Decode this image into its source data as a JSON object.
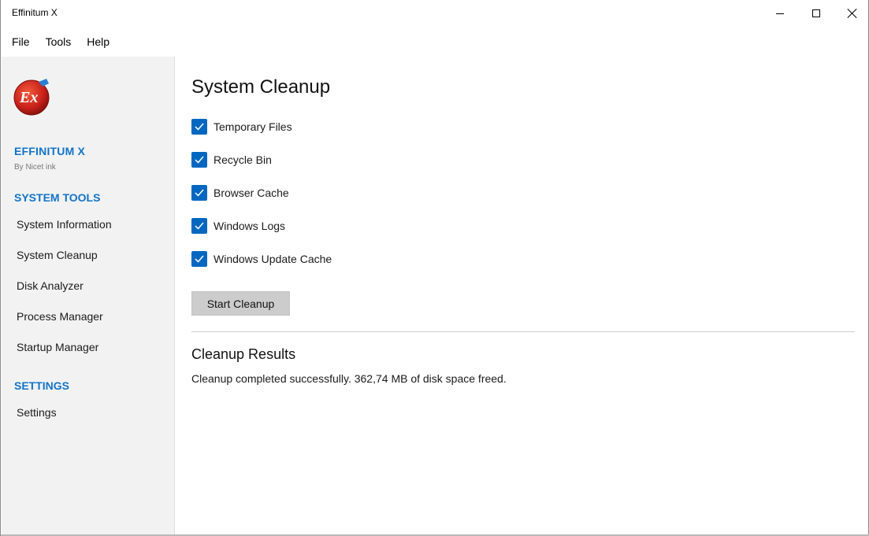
{
  "window": {
    "title": "Effinitum X"
  },
  "menu": [
    "File",
    "Tools",
    "Help"
  ],
  "sidebar": {
    "brand": "EFFINITUM X",
    "byline": "By Nicet ink",
    "logo_text": "Ex",
    "tools_title": "SYSTEM TOOLS",
    "tools": [
      "System Information",
      "System Cleanup",
      "Disk Analyzer",
      "Process Manager",
      "Startup Manager"
    ],
    "settings_title": "SETTINGS",
    "settings": [
      "Settings"
    ]
  },
  "main": {
    "title": "System Cleanup",
    "options": [
      {
        "label": "Temporary Files",
        "checked": true
      },
      {
        "label": "Recycle Bin",
        "checked": true
      },
      {
        "label": "Browser Cache",
        "checked": true
      },
      {
        "label": "Windows Logs",
        "checked": true
      },
      {
        "label": "Windows Update Cache",
        "checked": true
      }
    ],
    "start_button": "Start Cleanup",
    "results_title": "Cleanup Results",
    "results_text": "Cleanup completed successfully. 362,74 MB of disk space freed."
  },
  "colors": {
    "accent": "#1273c7",
    "checkbox": "#0067c0",
    "sidebar_bg": "#f2f2f2",
    "button_bg": "#cccccc"
  },
  "icons": [
    "effinitum-logo",
    "minimize-icon",
    "maximize-icon",
    "close-icon",
    "checkmark-icon"
  ]
}
